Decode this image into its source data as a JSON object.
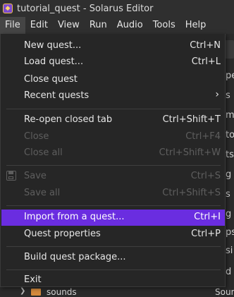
{
  "window": {
    "title": "tutorial_quest - Solarus Editor"
  },
  "menubar": {
    "items": [
      "File",
      "Edit",
      "View",
      "Run",
      "Audio",
      "Tools",
      "Help"
    ]
  },
  "background": {
    "right_fragments": [
      "pe",
      "s",
      "m",
      "to",
      "ts",
      "g",
      "s",
      "g",
      "ps",
      "si",
      "d"
    ],
    "tree_row": {
      "label": "sounds",
      "right": "Sound"
    }
  },
  "file_menu": {
    "items": [
      {
        "label": "New quest...",
        "shortcut": "Ctrl+N"
      },
      {
        "label": "Load quest...",
        "shortcut": "Ctrl+L"
      },
      {
        "label": "Close quest",
        "shortcut": ""
      },
      {
        "label": "Recent quests",
        "shortcut": ""
      },
      {
        "label": "Re-open closed tab",
        "shortcut": "Ctrl+Shift+T"
      },
      {
        "label": "Close",
        "shortcut": "Ctrl+F4"
      },
      {
        "label": "Close all",
        "shortcut": "Ctrl+Shift+W"
      },
      {
        "label": "Save",
        "shortcut": "Ctrl+S"
      },
      {
        "label": "Save all",
        "shortcut": "Ctrl+Shift+S"
      },
      {
        "label": "Import from a quest...",
        "shortcut": "Ctrl+I"
      },
      {
        "label": "Quest properties",
        "shortcut": "Ctrl+P"
      },
      {
        "label": "Build quest package...",
        "shortcut": ""
      },
      {
        "label": "Exit",
        "shortcut": ""
      }
    ]
  },
  "colors": {
    "highlight": "#6a2de0",
    "disabled_text": "#5e5e5e",
    "menu_bg": "#262626"
  }
}
